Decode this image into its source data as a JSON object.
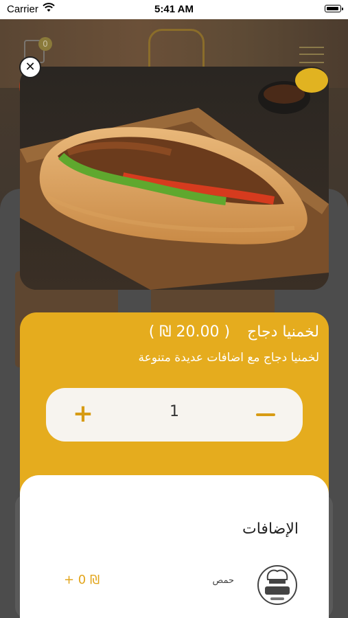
{
  "status_bar": {
    "carrier": "Carrier",
    "time": "5:41 AM"
  },
  "cart": {
    "count": "0"
  },
  "product": {
    "name": "لخمنيا دجاج",
    "price": "( 20.00 ₪ )",
    "description": "لخمنيا دجاج مع اضافات عديدة متنوعة",
    "quantity": "1"
  },
  "addons": {
    "title": "الإضافات",
    "items": [
      {
        "name": "حمص",
        "price": "+ 0 ₪",
        "logo_text": "مخبز ايبول"
      }
    ]
  },
  "colors": {
    "accent": "#e5ac1e",
    "accent_dark": "#d79b14",
    "card": "#ffffff"
  },
  "icons": [
    "wifi-icon",
    "battery-icon",
    "cart-icon",
    "menu-icon",
    "close-icon",
    "plus-icon",
    "minus-icon"
  ]
}
